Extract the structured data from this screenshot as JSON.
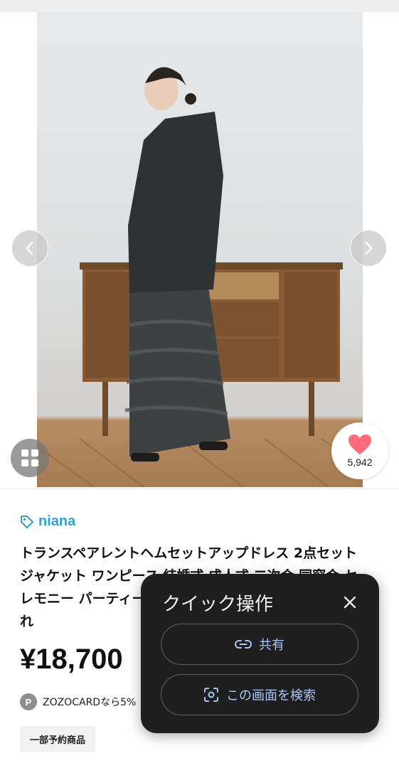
{
  "product": {
    "brand": "niana",
    "title_lines": [
      "トランスペアレントヘムセットアップドレス 2点セット",
      "ジャケット ワンピース 結婚式 成人式 二次会 同窓会 セ",
      "レモニー パーティー",
      "れ"
    ],
    "price": "¥18,700",
    "zozocard_badge": "P",
    "zozocard_text": "ZOZOCARDなら5%",
    "preorder_tag": "一部予約商品"
  },
  "favorite": {
    "count": "5,942",
    "color": "#ff6b7a"
  },
  "icons": {
    "prev": "chevron-left-icon",
    "next": "chevron-right-icon",
    "grid": "grid-icon",
    "heart": "heart-icon",
    "tag": "tag-icon"
  },
  "quick_actions": {
    "title": "クイック操作",
    "share_label": "共有",
    "search_label": "この画面を検索",
    "accent": "#a8c7fa"
  }
}
